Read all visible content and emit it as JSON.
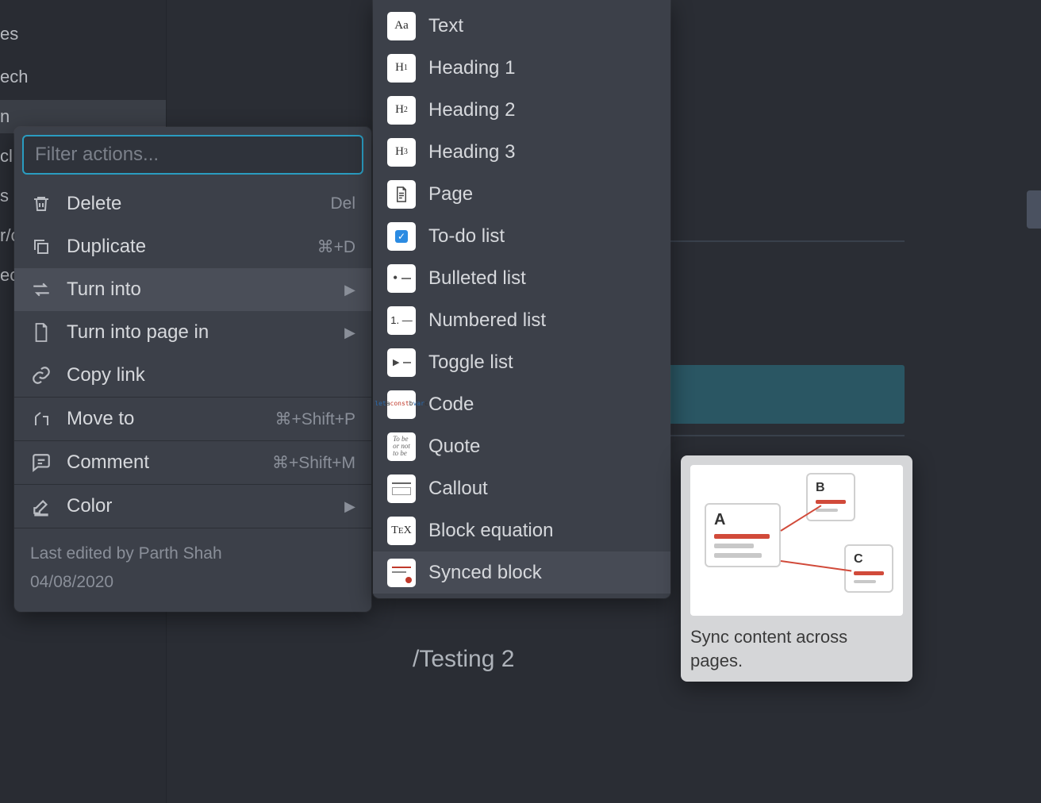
{
  "sidebar": {
    "items": [
      "es",
      "ech",
      "n",
      "cl",
      "s",
      "r/c",
      "ec"
    ]
  },
  "background": {
    "text_command": "/Testing 2"
  },
  "context_menu": {
    "filter_placeholder": "Filter actions...",
    "items": [
      {
        "icon": "trash-icon",
        "label": "Delete",
        "shortcut": "Del",
        "submenu": false
      },
      {
        "icon": "duplicate-icon",
        "label": "Duplicate",
        "shortcut": "⌘+D",
        "submenu": false
      },
      {
        "icon": "turn-into-icon",
        "label": "Turn into",
        "shortcut": "",
        "submenu": true,
        "highlight": true
      },
      {
        "icon": "page-icon",
        "label": "Turn into page in",
        "shortcut": "",
        "submenu": true
      },
      {
        "icon": "link-icon",
        "label": "Copy link",
        "shortcut": "",
        "submenu": false
      }
    ],
    "group2": [
      {
        "icon": "move-icon",
        "label": "Move to",
        "shortcut": "⌘+Shift+P",
        "submenu": false
      }
    ],
    "group3": [
      {
        "icon": "comment-icon",
        "label": "Comment",
        "shortcut": "⌘+Shift+M",
        "submenu": false
      }
    ],
    "group4": [
      {
        "icon": "color-icon",
        "label": "Color",
        "shortcut": "",
        "submenu": true
      }
    ],
    "footer_line1": "Last edited by Parth Shah",
    "footer_line2": "04/08/2020"
  },
  "turn_into_menu": {
    "items": [
      {
        "tile": "Aa",
        "label": "Text"
      },
      {
        "tile": "H1",
        "label": "Heading 1"
      },
      {
        "tile": "H2",
        "label": "Heading 2"
      },
      {
        "tile": "H3",
        "label": "Heading 3"
      },
      {
        "tile": "page",
        "label": "Page"
      },
      {
        "tile": "todo",
        "label": "To-do list"
      },
      {
        "tile": "bull",
        "label": "Bulleted list"
      },
      {
        "tile": "1.",
        "label": "Numbered list"
      },
      {
        "tile": "tgl",
        "label": "Toggle list"
      },
      {
        "tile": "code",
        "label": "Code"
      },
      {
        "tile": "quote",
        "label": "Quote"
      },
      {
        "tile": "call",
        "label": "Callout"
      },
      {
        "tile": "TEX",
        "label": "Block equation"
      },
      {
        "tile": "sync",
        "label": "Synced block",
        "highlight": true
      }
    ]
  },
  "preview": {
    "description": "Sync content across pages.",
    "cards": [
      "A",
      "B",
      "C"
    ]
  }
}
